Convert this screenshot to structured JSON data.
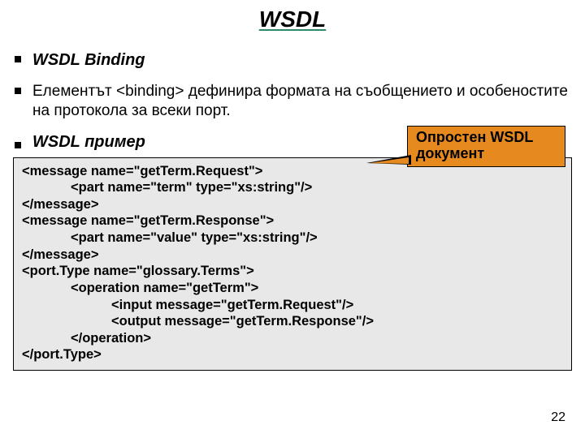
{
  "title": "WSDL",
  "bullets": {
    "heading1": "WSDL Binding",
    "body1": "Елементът <binding> дефинира формата на съобщението и особеностите на протокола за всеки порт.",
    "heading2": "WSDL пример"
  },
  "callout": {
    "line1": "Опростен WSDL",
    "line2": "документ"
  },
  "code": [
    {
      "indent": "",
      "text": "<message name=\"getTerm.Request\">"
    },
    {
      "indent": "i1",
      "text": "<part name=\"term\" type=\"xs:string\"/>"
    },
    {
      "indent": "",
      "text": "</message>"
    },
    {
      "indent": "",
      "text": "<message name=\"getTerm.Response\">"
    },
    {
      "indent": "i1",
      "text": "<part name=\"value\" type=\"xs:string\"/>"
    },
    {
      "indent": "",
      "text": "</message>"
    },
    {
      "indent": "",
      "text": "<port.Type name=\"glossary.Terms\">"
    },
    {
      "indent": "i1",
      "text": "<operation name=\"getTerm\">"
    },
    {
      "indent": "i2",
      "text": "<input message=\"getTerm.Request\"/>"
    },
    {
      "indent": "i2",
      "text": "<output message=\"getTerm.Response\"/>"
    },
    {
      "indent": "i1",
      "text": "</operation>"
    },
    {
      "indent": "",
      "text": "</port.Type>"
    }
  ],
  "page_number": "22"
}
